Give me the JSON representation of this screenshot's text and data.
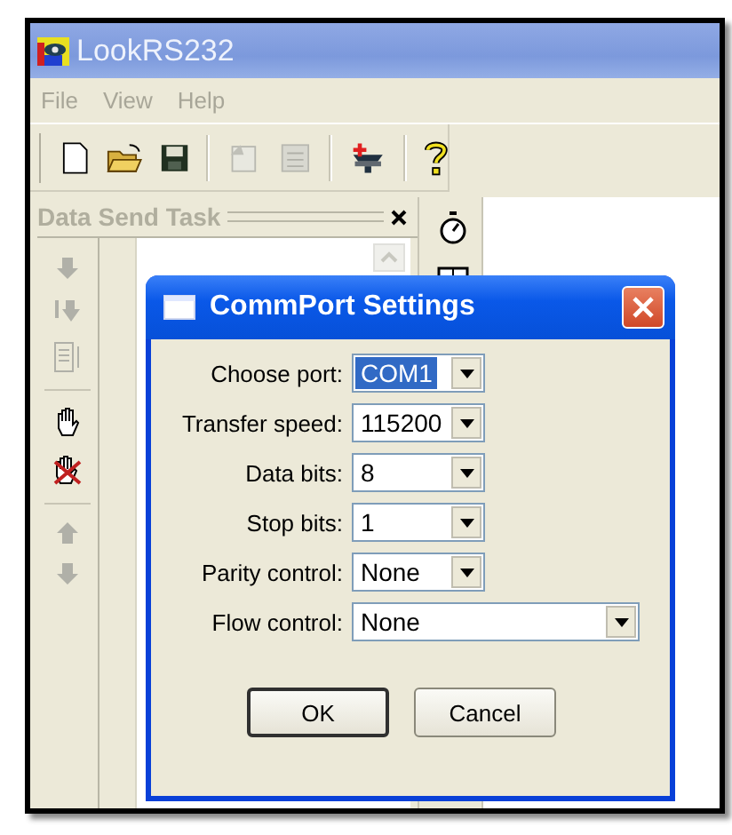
{
  "window": {
    "title": "LookRS232"
  },
  "menu": [
    {
      "label": "File",
      "disabled": true
    },
    {
      "label": "View",
      "disabled": true
    },
    {
      "label": "Help",
      "disabled": true
    }
  ],
  "panel": {
    "title": "Data Send Task"
  },
  "dialog": {
    "title": "CommPort Settings",
    "fields": [
      {
        "label": "Choose port:",
        "value": "COM1",
        "selected": true,
        "kind": "short"
      },
      {
        "label": "Transfer speed:",
        "value": "115200",
        "selected": false,
        "kind": "short"
      },
      {
        "label": "Data bits:",
        "value": "8",
        "selected": false,
        "kind": "short"
      },
      {
        "label": "Stop bits:",
        "value": "1",
        "selected": false,
        "kind": "short"
      },
      {
        "label": "Parity control:",
        "value": "None",
        "selected": false,
        "kind": "short"
      },
      {
        "label": "Flow control:",
        "value": "None",
        "selected": false,
        "kind": "long"
      }
    ],
    "buttons": [
      {
        "label": "OK",
        "default": true
      },
      {
        "label": "Cancel",
        "default": false
      }
    ]
  }
}
